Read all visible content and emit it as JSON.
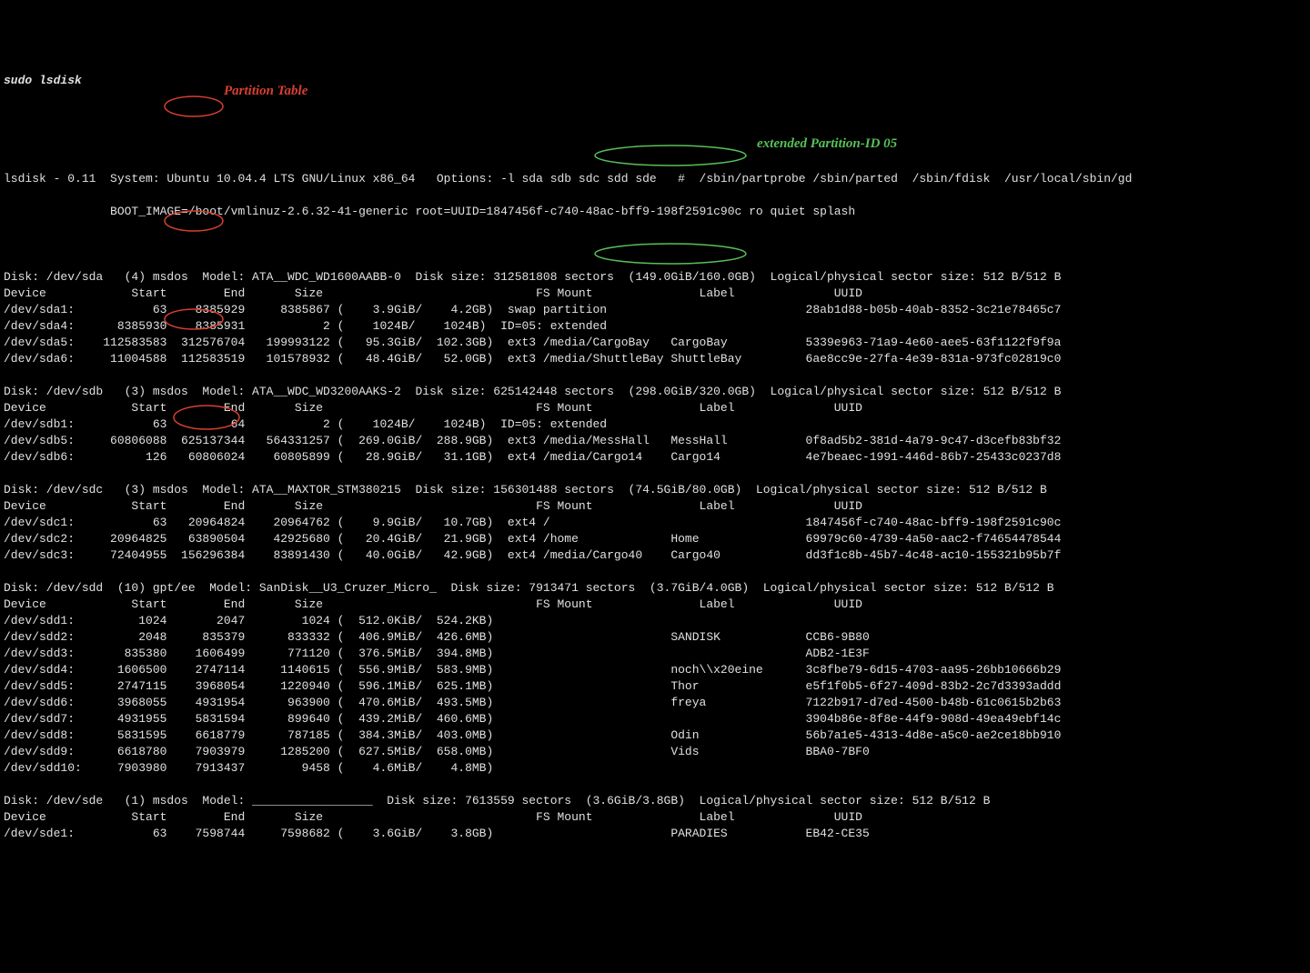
{
  "command": "sudo lsdisk",
  "header_sys": "lsdisk - 0.11  System: Ubuntu 10.04.4 LTS GNU/Linux x86_64   Options: -l sda sdb sdc sdd sde   #  /sbin/partprobe /sbin/parted  /sbin/fdisk  /usr/local/sbin/gd",
  "header_boot": "               BOOT_IMAGE=/boot/vmlinuz-2.6.32-41-generic root=UUID=1847456f-c740-48ac-bff9-198f2591c90c ro quiet splash",
  "anno_partition_table": "Partition Table",
  "anno_ext05": "extended Partition-ID 05",
  "disks": [
    {
      "header": "Disk: /dev/sda   (4) msdos  Model: ATA__WDC_WD1600AABB-0  Disk size: 312581808 sectors  (149.0GiB/160.0GB)  Logical/physical sector size: 512 B/512 B",
      "cols": "Device            Start        End       Size                              FS Mount               Label              UUID",
      "rows": [
        "/dev/sda1:           63    8385929     8385867 (    3.9GiB/    4.2GB)  swap partition                            28ab1d88-b05b-40ab-8352-3c21e78465c7",
        "/dev/sda4:      8385930    8385931           2 (    1024B/    1024B)  ID=05: extended",
        "/dev/sda5:    112583583  312576704   199993122 (   95.3GiB/  102.3GB)  ext3 /media/CargoBay   CargoBay           5339e963-71a9-4e60-aee5-63f1122f9f9a",
        "/dev/sda6:     11004588  112583519   101578932 (   48.4GiB/   52.0GB)  ext3 /media/ShuttleBay ShuttleBay         6ae8cc9e-27fa-4e39-831a-973fc02819c0"
      ]
    },
    {
      "header": "Disk: /dev/sdb   (3) msdos  Model: ATA__WDC_WD3200AAKS-2  Disk size: 625142448 sectors  (298.0GiB/320.0GB)  Logical/physical sector size: 512 B/512 B",
      "cols": "Device            Start        End       Size                              FS Mount               Label              UUID",
      "rows": [
        "/dev/sdb1:           63         64           2 (    1024B/    1024B)  ID=05: extended",
        "/dev/sdb5:     60806088  625137344   564331257 (  269.0GiB/  288.9GB)  ext3 /media/MessHall   MessHall           0f8ad5b2-381d-4a79-9c47-d3cefb83bf32",
        "/dev/sdb6:          126   60806024    60805899 (   28.9GiB/   31.1GB)  ext4 /media/Cargo14    Cargo14            4e7beaec-1991-446d-86b7-25433c0237d8"
      ]
    },
    {
      "header": "Disk: /dev/sdc   (3) msdos  Model: ATA__MAXTOR_STM380215  Disk size: 156301488 sectors  (74.5GiB/80.0GB)  Logical/physical sector size: 512 B/512 B",
      "cols": "Device            Start        End       Size                              FS Mount               Label              UUID",
      "rows": [
        "/dev/sdc1:           63   20964824    20964762 (    9.9GiB/   10.7GB)  ext4 /                                    1847456f-c740-48ac-bff9-198f2591c90c",
        "/dev/sdc2:     20964825   63890504    42925680 (   20.4GiB/   21.9GB)  ext4 /home             Home               69979c60-4739-4a50-aac2-f74654478544",
        "/dev/sdc3:     72404955  156296384    83891430 (   40.0GiB/   42.9GB)  ext4 /media/Cargo40    Cargo40            dd3f1c8b-45b7-4c48-ac10-155321b95b7f"
      ]
    },
    {
      "header": "Disk: /dev/sdd  (10) gpt/ee  Model: SanDisk__U3_Cruzer_Micro_  Disk size: 7913471 sectors  (3.7GiB/4.0GB)  Logical/physical sector size: 512 B/512 B",
      "cols": "Device            Start        End       Size                              FS Mount               Label              UUID",
      "rows": [
        "/dev/sdd1:         1024       2047        1024 (  512.0KiB/  524.2KB)",
        "/dev/sdd2:         2048     835379      833332 (  406.9MiB/  426.6MB)                         SANDISK            CCB6-9B80",
        "/dev/sdd3:       835380    1606499      771120 (  376.5MiB/  394.8MB)                                            ADB2-1E3F",
        "/dev/sdd4:      1606500    2747114     1140615 (  556.9MiB/  583.9MB)                         noch\\\\x20eine      3c8fbe79-6d15-4703-aa95-26bb10666b29",
        "/dev/sdd5:      2747115    3968054     1220940 (  596.1MiB/  625.1MB)                         Thor               e5f1f0b5-6f27-409d-83b2-2c7d3393addd",
        "/dev/sdd6:      3968055    4931954      963900 (  470.6MiB/  493.5MB)                         freya              7122b917-d7ed-4500-b48b-61c0615b2b63",
        "/dev/sdd7:      4931955    5831594      899640 (  439.2MiB/  460.6MB)                                            3904b86e-8f8e-44f9-908d-49ea49ebf14c",
        "/dev/sdd8:      5831595    6618779      787185 (  384.3MiB/  403.0MB)                         Odin               56b7a1e5-4313-4d8e-a5c0-ae2ce18bb910",
        "/dev/sdd9:      6618780    7903979     1285200 (  627.5MiB/  658.0MB)                         Vids               BBA0-7BF0",
        "/dev/sdd10:     7903980    7913437        9458 (    4.6MiB/    4.8MB)"
      ]
    },
    {
      "header": "Disk: /dev/sde   (1) msdos  Model: _________________  Disk size: 7613559 sectors  (3.6GiB/3.8GB)  Logical/physical sector size: 512 B/512 B",
      "cols": "Device            Start        End       Size                              FS Mount               Label              UUID",
      "rows": [
        "/dev/sde1:           63    7598744     7598682 (    3.6GiB/    3.8GB)                         PARADIES           EB42-CE35"
      ]
    }
  ]
}
